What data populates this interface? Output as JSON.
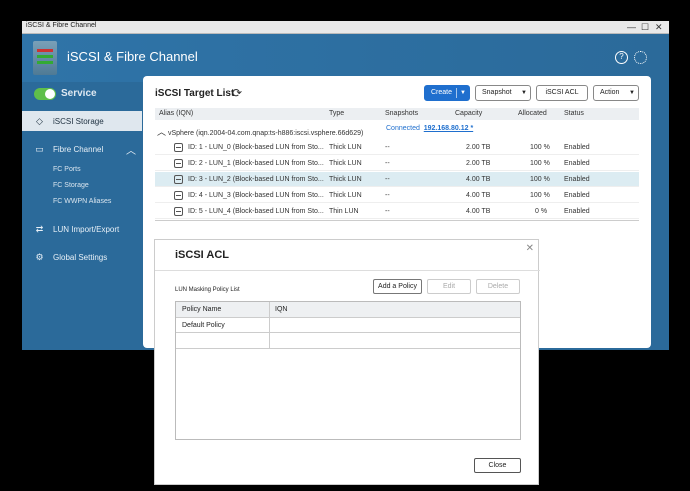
{
  "window": {
    "title": "iSCSI & Fibre Channel"
  },
  "header": {
    "app_title": "iSCSI & Fibre Channel",
    "help_icon": "help-icon",
    "settings_icon": "gear-icon"
  },
  "sidebar": {
    "service_label": "Service",
    "service_on": true,
    "items": [
      {
        "label": "iSCSI Storage",
        "icon": "storage-icon",
        "active": true
      },
      {
        "label": "Fibre Channel",
        "icon": "fibre-icon",
        "active": false
      },
      {
        "label": "LUN Import/Export",
        "icon": "import-export-icon",
        "active": false
      },
      {
        "label": "Global Settings",
        "icon": "gear-icon",
        "active": false
      }
    ],
    "fibre_sub": [
      "FC Ports",
      "FC Storage",
      "FC WWPN Aliases"
    ]
  },
  "panel": {
    "title": "iSCSI Target List",
    "buttons": {
      "create": "Create",
      "snapshot": "Snapshot",
      "iscsi_acl": "iSCSI ACL",
      "action": "Action"
    },
    "columns": [
      "Alias (IQN)",
      "Type",
      "Snapshots",
      "Capacity",
      "Allocated",
      "Status"
    ],
    "group": {
      "name": "vSphere (iqn.2004-04.com.qnap:ts-h886:iscsi.vsphere.66d629)",
      "status": "Connected",
      "ip": "192.168.80.12 *"
    },
    "rows": [
      {
        "alias": "ID: 1 - LUN_0 (Block-based LUN from Sto...",
        "type": "Thick LUN",
        "snapshots": "--",
        "capacity": "2.00 TB",
        "allocated": "100 %",
        "status": "Enabled"
      },
      {
        "alias": "ID: 2 - LUN_1 (Block-based LUN from Sto...",
        "type": "Thick LUN",
        "snapshots": "--",
        "capacity": "2.00 TB",
        "allocated": "100 %",
        "status": "Enabled"
      },
      {
        "alias": "ID: 3 - LUN_2 (Block-based LUN from Sto...",
        "type": "Thick LUN",
        "snapshots": "--",
        "capacity": "4.00 TB",
        "allocated": "100 %",
        "status": "Enabled"
      },
      {
        "alias": "ID: 4 - LUN_3 (Block-based LUN from Sto...",
        "type": "Thick LUN",
        "snapshots": "--",
        "capacity": "4.00 TB",
        "allocated": "100 %",
        "status": "Enabled"
      },
      {
        "alias": "ID: 5 - LUN_4 (Block-based LUN from Sto...",
        "type": "Thin LUN",
        "snapshots": "--",
        "capacity": "4.00 TB",
        "allocated": "0 %",
        "status": "Enabled"
      }
    ]
  },
  "dialog": {
    "title": "iSCSI ACL",
    "list_label": "LUN Masking Policy List",
    "buttons": {
      "add": "Add a Policy",
      "edit": "Edit",
      "delete": "Delete",
      "close": "Close"
    },
    "columns": [
      "Policy Name",
      "IQN"
    ],
    "rows": [
      {
        "policy": "Default Policy",
        "iqn": ""
      }
    ]
  },
  "colors": {
    "accent": "#1f6fce",
    "sidebar_bg": "#2b6a9a",
    "service_on": "#5fbf4a"
  }
}
